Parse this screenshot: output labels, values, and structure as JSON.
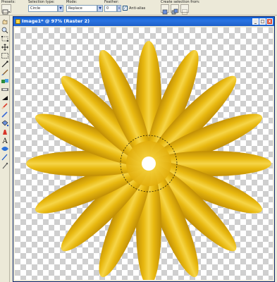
{
  "options_bar": {
    "presets_label": "Presets:",
    "selection_type_label": "Selection type:",
    "selection_type_value": "Circle",
    "mode_label": "Mode:",
    "mode_value": "Replace",
    "feather_label": "Feather:",
    "feather_value": "0",
    "antialias_label": "Anti-alias",
    "antialias_checked": true,
    "create_selection_label": "Create selection from:"
  },
  "toolbox": {
    "tools": [
      "pan-icon",
      "zoom-icon",
      "deform-icon",
      "move-icon",
      "selection-icon",
      "dropper-icon",
      "paint-brush-icon",
      "clone-brush-icon",
      "scratch-remover-icon",
      "dodge-icon",
      "eraser-icon",
      "background-eraser-icon",
      "flood-fill-icon",
      "picture-tube-icon",
      "text-icon",
      "preset-shape-icon",
      "pen-icon",
      "warp-brush-icon"
    ]
  },
  "document": {
    "title": "Image1* @ 97% (Raster 2)",
    "minimize": "_",
    "maximize": "□",
    "close": "x"
  },
  "colors": {
    "petal": "#e8b80f",
    "petal_dark": "#c08e06",
    "petal_light": "#f6d548",
    "title_bar": "#0a5fd8"
  }
}
